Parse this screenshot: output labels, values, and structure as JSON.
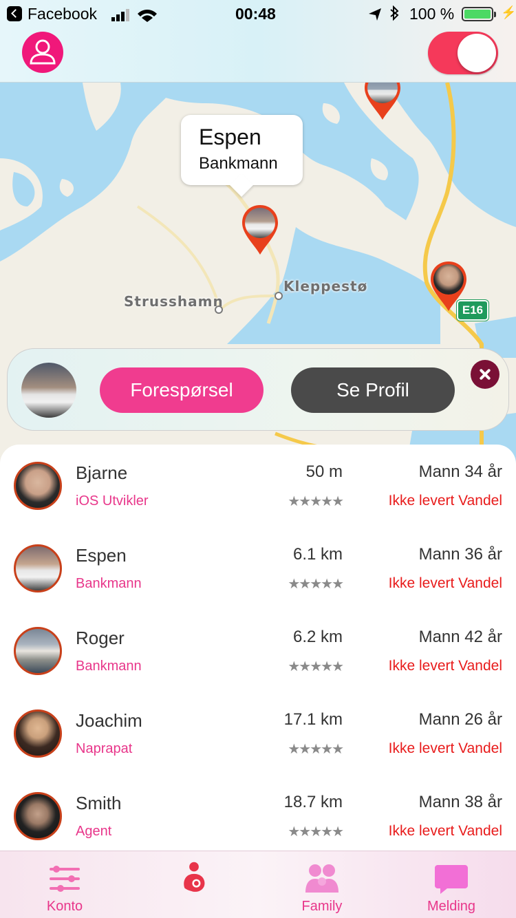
{
  "status_bar": {
    "back_app": "Facebook",
    "time": "00:48",
    "battery_percent": "100 %",
    "battery_color": "#4cd964"
  },
  "header": {
    "profile_icon": "person-icon",
    "toggle_on": true,
    "toggle_color": "#f5395a"
  },
  "map": {
    "places": [
      "Strusshamn",
      "Kleppestø"
    ],
    "road_badge": "E16",
    "callout": {
      "name": "Espen",
      "role": "Bankmann"
    }
  },
  "profile_card": {
    "request_label": "Forespørsel",
    "profile_label": "Se Profil",
    "close_icon": "close-icon"
  },
  "people": [
    {
      "name": "Bjarne",
      "role": "iOS Utvikler",
      "distance": "50 m",
      "stars": "★★★★★",
      "gender_age": "Mann  34 år",
      "vandel": "Ikke levert Vandel"
    },
    {
      "name": "Espen",
      "role": "Bankmann",
      "distance": "6.1 km",
      "stars": "★★★★★",
      "gender_age": "Mann  36 år",
      "vandel": "Ikke levert Vandel"
    },
    {
      "name": "Roger",
      "role": "Bankmann",
      "distance": "6.2 km",
      "stars": "★★★★★",
      "gender_age": "Mann  42 år",
      "vandel": "Ikke levert Vandel"
    },
    {
      "name": "Joachim",
      "role": "Naprapat",
      "distance": "17.1 km",
      "stars": "★★★★★",
      "gender_age": "Mann  26 år",
      "vandel": "Ikke levert Vandel"
    },
    {
      "name": "Smith",
      "role": "Agent",
      "distance": "18.7 km",
      "stars": "★★★★★",
      "gender_age": "Mann  38 år",
      "vandel": "Ikke levert Vandel"
    }
  ],
  "tabs": [
    {
      "label": "Konto",
      "icon": "sliders-icon"
    },
    {
      "label": "",
      "icon": "mother-child-icon"
    },
    {
      "label": "Family",
      "icon": "family-icon"
    },
    {
      "label": "Melding",
      "icon": "message-icon"
    }
  ],
  "colors": {
    "accent_pink": "#e8368a",
    "button_pink": "#f03c8f",
    "button_dark": "#4a4a4a",
    "warning_red": "#e81b1b",
    "pin_red": "#e8401c"
  }
}
